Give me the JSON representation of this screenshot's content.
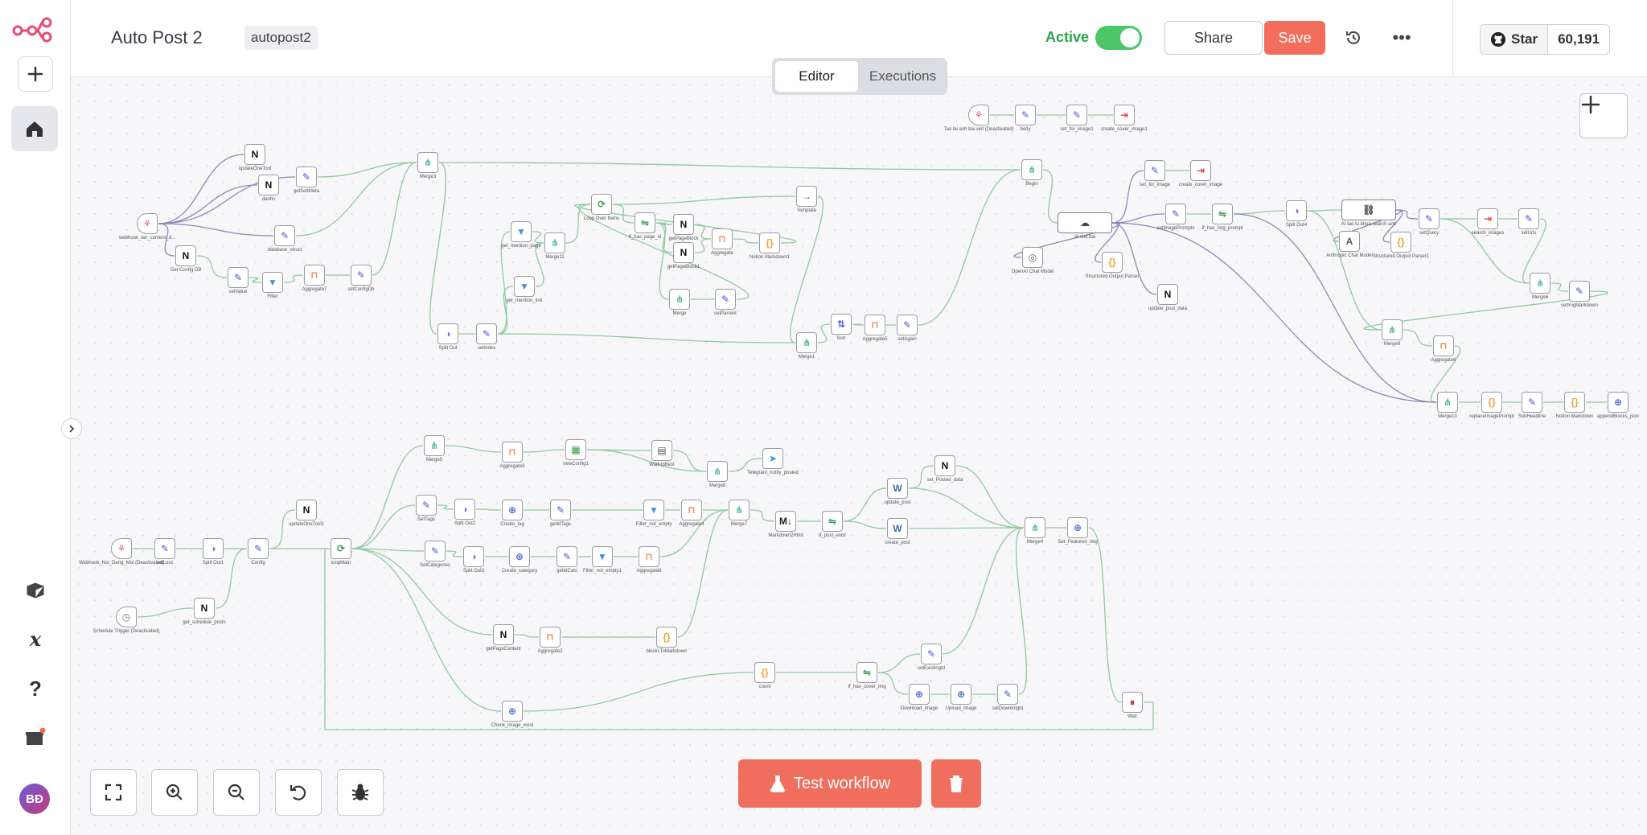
{
  "sidebar": {
    "avatar_initials": "BĐ",
    "icons": [
      "n8n-logo-icon",
      "plus-icon",
      "home-icon",
      "templates-box-icon",
      "variables-icon",
      "help-icon",
      "gift-icon"
    ]
  },
  "header": {
    "workflow_title": "Auto Post 2",
    "workflow_tag": "autopost2",
    "active_label": "Active",
    "active": true,
    "share_label": "Share",
    "save_label": "Save",
    "github_star_label": "Star",
    "github_star_count": "60,191"
  },
  "tabs": [
    {
      "label": "Editor",
      "active": true
    },
    {
      "label": "Executions",
      "active": false
    }
  ],
  "canvas": {
    "nodes": [
      {
        "id": "n1",
        "label": "webhook_lan_content_d...",
        "icon": "webhook"
      },
      {
        "id": "n2",
        "label": "updateOneTool",
        "icon": "notion"
      },
      {
        "id": "n3",
        "label": "danhs",
        "icon": "notion"
      },
      {
        "id": "n4",
        "label": "getSettMeta",
        "icon": "edit"
      },
      {
        "id": "n5",
        "label": "database_struct",
        "icon": "edit"
      },
      {
        "id": "n6",
        "label": "Get Config DB",
        "icon": "notion"
      },
      {
        "id": "n7",
        "label": "setValue",
        "icon": "edit"
      },
      {
        "id": "n8",
        "label": "Filter",
        "icon": "filter"
      },
      {
        "id": "n9",
        "label": "Aggregate7",
        "icon": "aggregate"
      },
      {
        "id": "n10",
        "label": "setConfigDb",
        "icon": "edit"
      },
      {
        "id": "n11",
        "label": "Merge3",
        "icon": "merge"
      },
      {
        "id": "n12",
        "label": "Split Out",
        "icon": "split"
      },
      {
        "id": "n13",
        "label": "setindex",
        "icon": "edit"
      },
      {
        "id": "n14",
        "label": "get_mention_page",
        "icon": "filter"
      },
      {
        "id": "n15",
        "label": "get_mention_link",
        "icon": "filter"
      },
      {
        "id": "n16",
        "label": "Merge11",
        "icon": "merge"
      },
      {
        "id": "n17",
        "label": "Loop Over Items",
        "icon": "loop"
      },
      {
        "id": "n18",
        "label": "If_has_page_id",
        "icon": "if"
      },
      {
        "id": "n19",
        "label": "getPageBlock",
        "icon": "notion"
      },
      {
        "id": "n20",
        "label": "getPageBlock1",
        "icon": "notion"
      },
      {
        "id": "n21",
        "label": "Aggregate",
        "icon": "aggregate"
      },
      {
        "id": "n22",
        "label": "Notion Markdown1",
        "icon": "code"
      },
      {
        "id": "n23",
        "label": "Template",
        "icon": "arrow"
      },
      {
        "id": "n24",
        "label": "Merge",
        "icon": "merge"
      },
      {
        "id": "n25",
        "label": "setParrent",
        "icon": "edit"
      },
      {
        "id": "n26",
        "label": "Merge1",
        "icon": "merge"
      },
      {
        "id": "n27",
        "label": "Sort",
        "icon": "sort"
      },
      {
        "id": "n28",
        "label": "Aggregate5",
        "icon": "aggregate"
      },
      {
        "id": "n29",
        "label": "setAgain",
        "icon": "edit"
      },
      {
        "id": "n30",
        "label": "Tao lai anh bai viet (Deactivated)",
        "icon": "webhook"
      },
      {
        "id": "n31",
        "label": "body",
        "icon": "edit"
      },
      {
        "id": "n32",
        "label": "set_for_image1",
        "icon": "edit"
      },
      {
        "id": "n33",
        "label": "create_cover_image1",
        "icon": "exec"
      },
      {
        "id": "n34",
        "label": "Begin",
        "icon": "merge"
      },
      {
        "id": "n35",
        "label": "AI viet bai",
        "icon": "ai"
      },
      {
        "id": "n36",
        "label": "OpenAI Chat Model",
        "icon": "openai"
      },
      {
        "id": "n37",
        "label": "Structured Output Parser",
        "icon": "code"
      },
      {
        "id": "n38",
        "label": "set_for_image",
        "icon": "edit"
      },
      {
        "id": "n39",
        "label": "create_cover_image",
        "icon": "exec"
      },
      {
        "id": "n40",
        "label": "setImagePrompts",
        "icon": "edit"
      },
      {
        "id": "n41",
        "label": "If_has_img_prompt",
        "icon": "if"
      },
      {
        "id": "n42",
        "label": "update_post_data",
        "icon": "notion"
      },
      {
        "id": "n43",
        "label": "Split Out4",
        "icon": "split"
      },
      {
        "id": "n44",
        "label": "AI tao tu khoa search anh",
        "icon": "link"
      },
      {
        "id": "n45",
        "label": "Anthropic Chat Model",
        "icon": "anthropic"
      },
      {
        "id": "n46",
        "label": "Structured Output Parser1",
        "icon": "code"
      },
      {
        "id": "n47",
        "label": "setQuery",
        "icon": "edit"
      },
      {
        "id": "n48",
        "label": "search_images",
        "icon": "exec"
      },
      {
        "id": "n49",
        "label": "setUrls",
        "icon": "edit"
      },
      {
        "id": "n50",
        "label": "Merge6",
        "icon": "merge"
      },
      {
        "id": "n51",
        "label": "setImgMarkdown",
        "icon": "edit"
      },
      {
        "id": "n52",
        "label": "Merge9",
        "icon": "merge"
      },
      {
        "id": "n53",
        "label": "Aggregate6",
        "icon": "aggregate"
      },
      {
        "id": "n54",
        "label": "Merge10",
        "icon": "merge"
      },
      {
        "id": "n55",
        "label": "replaceImagePrompt",
        "icon": "code"
      },
      {
        "id": "n56",
        "label": "SubHeadline",
        "icon": "edit"
      },
      {
        "id": "n57",
        "label": "Notion Markdown",
        "icon": "code"
      },
      {
        "id": "n58",
        "label": "appendBlocks_json",
        "icon": "http"
      },
      {
        "id": "n59",
        "label": "Webhook_Noi_Dung_Moi (Deactivated)",
        "icon": "webhook"
      },
      {
        "id": "n60",
        "label": "setLuss",
        "icon": "edit"
      },
      {
        "id": "n61",
        "label": "Split Out1",
        "icon": "split"
      },
      {
        "id": "n62",
        "label": "Config",
        "icon": "edit"
      },
      {
        "id": "n63",
        "label": "updateOneTool1",
        "icon": "notion"
      },
      {
        "id": "n64",
        "label": "Schedule Trigger (Deactivated)",
        "icon": "clock"
      },
      {
        "id": "n65",
        "label": "get_schedule_posts",
        "icon": "notion"
      },
      {
        "id": "n66",
        "label": "loopMain",
        "icon": "loop"
      },
      {
        "id": "n67",
        "label": "Merge5",
        "icon": "merge"
      },
      {
        "id": "n68",
        "label": "Aggregate3",
        "icon": "aggregate"
      },
      {
        "id": "n69",
        "label": "newConfig1",
        "icon": "sheet"
      },
      {
        "id": "n70",
        "label": "WaitUpBest",
        "icon": "doc"
      },
      {
        "id": "n71",
        "label": "Merge8",
        "icon": "merge"
      },
      {
        "id": "n72",
        "label": "Telegram_notify_posted",
        "icon": "telegram"
      },
      {
        "id": "n73",
        "label": "SetTags",
        "icon": "edit"
      },
      {
        "id": "n74",
        "label": "Split Out2",
        "icon": "split"
      },
      {
        "id": "n75",
        "label": "Create_tag",
        "icon": "http"
      },
      {
        "id": "n76",
        "label": "getIdTags",
        "icon": "edit"
      },
      {
        "id": "n77",
        "label": "Filter_not_empty",
        "icon": "filter"
      },
      {
        "id": "n78",
        "label": "Aggregate4",
        "icon": "aggregate"
      },
      {
        "id": "n79",
        "label": "Merge7",
        "icon": "merge"
      },
      {
        "id": "n80",
        "label": "Markdown2Html",
        "icon": "md"
      },
      {
        "id": "n81",
        "label": "If_post_exist",
        "icon": "if"
      },
      {
        "id": "n82",
        "label": "update_post",
        "icon": "wordpress"
      },
      {
        "id": "n83",
        "label": "set_Posted_data",
        "icon": "notion"
      },
      {
        "id": "n84",
        "label": "create_post",
        "icon": "wordpress"
      },
      {
        "id": "n85",
        "label": "Merge4",
        "icon": "merge"
      },
      {
        "id": "n86",
        "label": "Set_Featured_img",
        "icon": "http"
      },
      {
        "id": "n87",
        "label": "SetCategories",
        "icon": "edit"
      },
      {
        "id": "n88",
        "label": "Split Out3",
        "icon": "split"
      },
      {
        "id": "n89",
        "label": "Create_category",
        "icon": "http"
      },
      {
        "id": "n90",
        "label": "getIdCats",
        "icon": "edit"
      },
      {
        "id": "n91",
        "label": "Filter_not_empty1",
        "icon": "filter"
      },
      {
        "id": "n92",
        "label": "Aggregate8",
        "icon": "aggregate"
      },
      {
        "id": "n93",
        "label": "getPageContent",
        "icon": "notion"
      },
      {
        "id": "n94",
        "label": "Aggregate2",
        "icon": "aggregate"
      },
      {
        "id": "n95",
        "label": "blocksToMarkdown",
        "icon": "code"
      },
      {
        "id": "n96",
        "label": "count",
        "icon": "code"
      },
      {
        "id": "n97",
        "label": "If_has_cover_img",
        "icon": "if"
      },
      {
        "id": "n98",
        "label": "setExistingId",
        "icon": "edit"
      },
      {
        "id": "n99",
        "label": "Download_image",
        "icon": "http"
      },
      {
        "id": "n100",
        "label": "Upload_image",
        "icon": "http"
      },
      {
        "id": "n101",
        "label": "setDownImgId",
        "icon": "edit"
      },
      {
        "id": "n102",
        "label": "Check_image_exist",
        "icon": "http"
      },
      {
        "id": "n103",
        "label": "Wait",
        "icon": "wait"
      }
    ]
  },
  "controls": {
    "test_workflow_label": "Test workflow"
  }
}
